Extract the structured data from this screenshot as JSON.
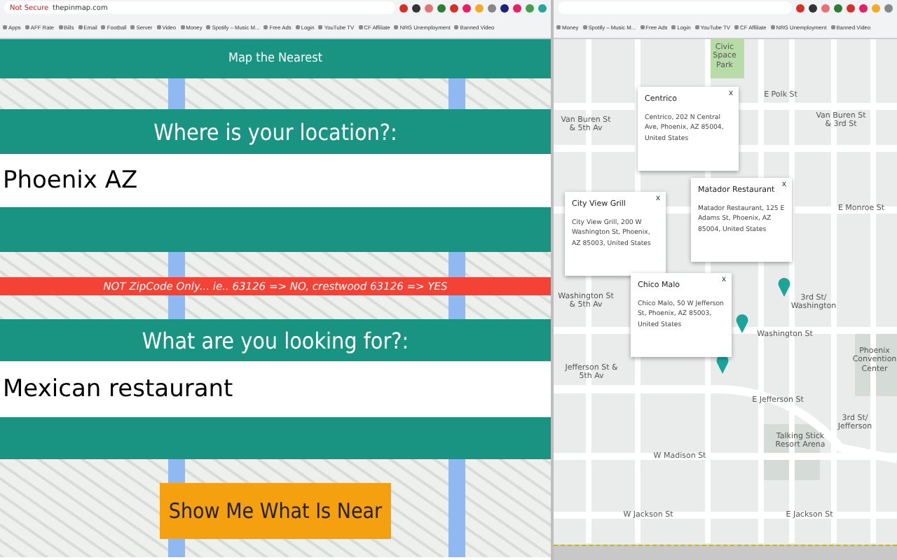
{
  "left_browser": {
    "address": {
      "security": "Not Secure",
      "url": "thepinmap.com"
    },
    "bookmarks": [
      "Apps",
      "AFF Rate",
      "Bills",
      "Email",
      "Football",
      "Server",
      "Video",
      "Money",
      "Spotify – Music M...",
      "Free Ads",
      "Login",
      "YouTube TV",
      "CF Affiliate",
      "NRG Unemployment",
      "Banned Video"
    ]
  },
  "page": {
    "title": "Map the Nearest",
    "location": {
      "label": "Where is your location?:",
      "value": "Phoenix AZ"
    },
    "notice": "NOT ZipCode Only... ie.. 63126 => NO, crestwood 63126 => YES",
    "search": {
      "label": "What are you looking for?:",
      "value": "Mexican restaurant"
    },
    "submit": "Show Me What Is Near"
  },
  "right_browser": {
    "bookmarks": [
      "Money",
      "Spotify – Music M...",
      "Free Ads",
      "Login",
      "YouTube TV",
      "CF Affiliate",
      "NRG Unemployment",
      "Banned Video"
    ]
  },
  "map": {
    "labels": [
      "Civic Space Park",
      "E Polk St",
      "Van Buren St & 5th Av",
      "Van Buren St & 3rd St",
      "E Monroe St",
      "Washington St & 5th Av",
      "Washington St",
      "3rd St/ Washington",
      "Jefferson St & 5th Av",
      "E Jefferson St",
      "Phoenix Convention Center",
      "3rd St/ Jefferson",
      "Talking Stick Resort Arena",
      "W Madison St",
      "W Jackson St",
      "E Jackson St"
    ],
    "popups": [
      {
        "title": "Centrico",
        "address": "Centrico, 202 N Central Ave, Phoenix, AZ 85004, United States",
        "close": "x"
      },
      {
        "title": "City View Grill",
        "address": "City View Grill, 200 W Washington St, Phoenix, AZ 85003, United States",
        "close": "x"
      },
      {
        "title": "Matador Restaurant",
        "address": "Matador Restaurant, 125 E Adams St, Phoenix, AZ 85004, United States",
        "close": "x"
      },
      {
        "title": "Chico Malo",
        "address": "Chico Malo, 50 W Jefferson St, Phoenix, AZ 85003, United States",
        "close": "x"
      }
    ]
  }
}
